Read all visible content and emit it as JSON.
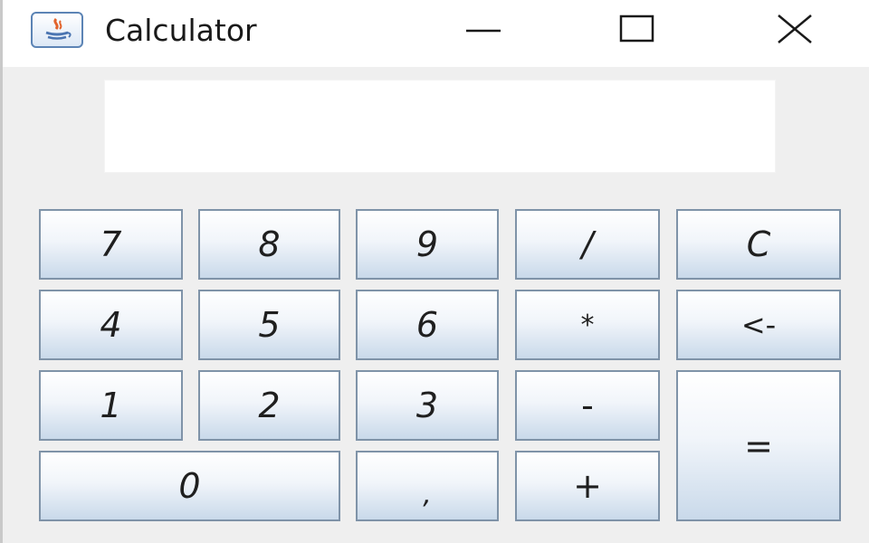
{
  "window": {
    "title": "Calculator",
    "icon": "java-app-icon",
    "controls": {
      "minimize": "minimize-icon",
      "maximize": "maximize-icon",
      "close": "close-icon"
    }
  },
  "display": {
    "value": ""
  },
  "keys": {
    "k7": "7",
    "k8": "8",
    "k9": "9",
    "divide": "/",
    "clear": "C",
    "k4": "4",
    "k5": "5",
    "k6": "6",
    "multiply": "*",
    "backspace": "<-",
    "k1": "1",
    "k2": "2",
    "k3": "3",
    "subtract": "-",
    "equals": "=",
    "k0": "0",
    "decimal": ",",
    "add": "+"
  },
  "colors": {
    "button_border": "#7f93a8",
    "button_gradient_bottom": "#c9d9ea",
    "window_background": "#efefef"
  }
}
